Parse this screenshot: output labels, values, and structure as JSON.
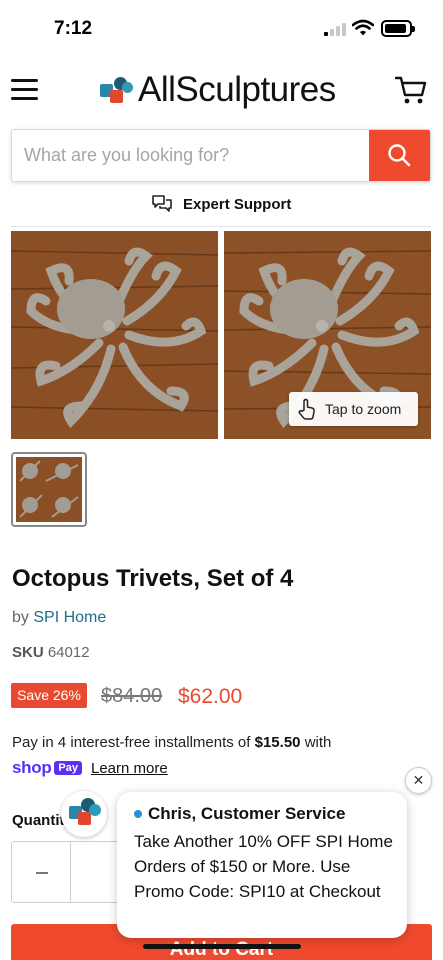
{
  "status": {
    "time": "7:12"
  },
  "header": {
    "brand": "AllSculptures"
  },
  "search": {
    "placeholder": "What are you looking for?"
  },
  "support": {
    "label": "Expert Support"
  },
  "gallery": {
    "zoom_label": "Tap to zoom"
  },
  "product": {
    "title": "Octopus Trivets, Set of 4",
    "vendor_prefix": "by",
    "vendor": "SPI Home",
    "sku_label": "SKU",
    "sku": "64012",
    "save_badge": "Save 26%",
    "compare_price": "$84.00",
    "price": "$62.00",
    "installments_text": "Pay in 4 interest-free installments of",
    "installment_amount": "$15.50",
    "installments_suffix": "with",
    "shop_text": "shop",
    "pay_text": "Pay",
    "learn_more": "Learn more",
    "quantity_label": "Quantity",
    "add_to_cart": "Add to Cart"
  },
  "chat": {
    "agent": "Chris, Customer Service",
    "message": "Take Another 10% OFF SPI Home Orders of $150 or More. Use Promo Code: SPI10 at Checkout",
    "close": "✕"
  },
  "colors": {
    "accent": "#f04a2e",
    "shop_pay": "#5a31f4",
    "link": "#1d6f8c"
  }
}
